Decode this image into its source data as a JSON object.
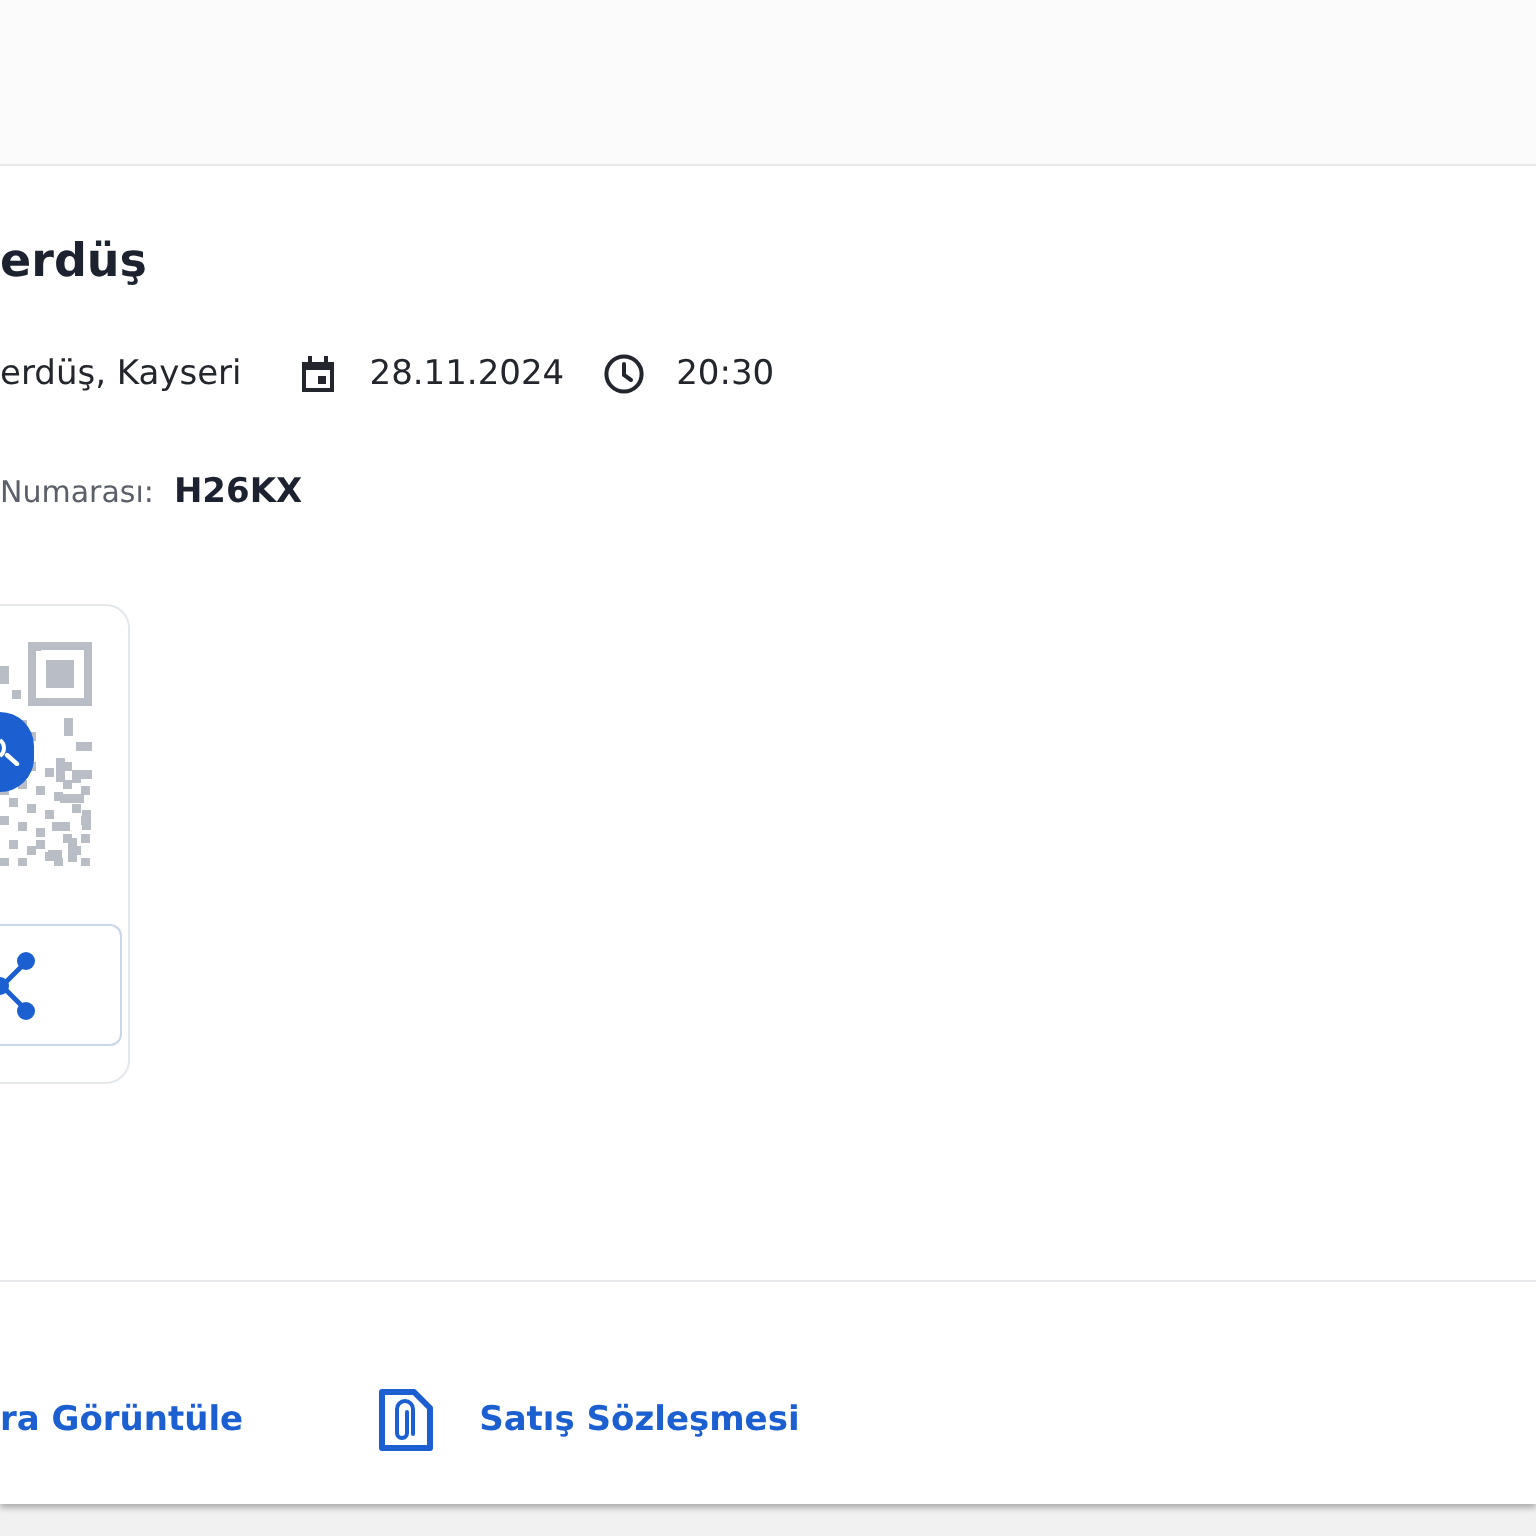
{
  "event": {
    "title": "erdüş",
    "location": "erdüş, Kayseri",
    "date": "28.11.2024",
    "time": "20:30"
  },
  "ticket": {
    "label": "Numarası:",
    "code": "H26KX"
  },
  "actions": [
    {
      "kind": "link",
      "label": "ra Görüntüle"
    },
    {
      "kind": "document",
      "label": "Satış Sözleşmesi"
    }
  ]
}
